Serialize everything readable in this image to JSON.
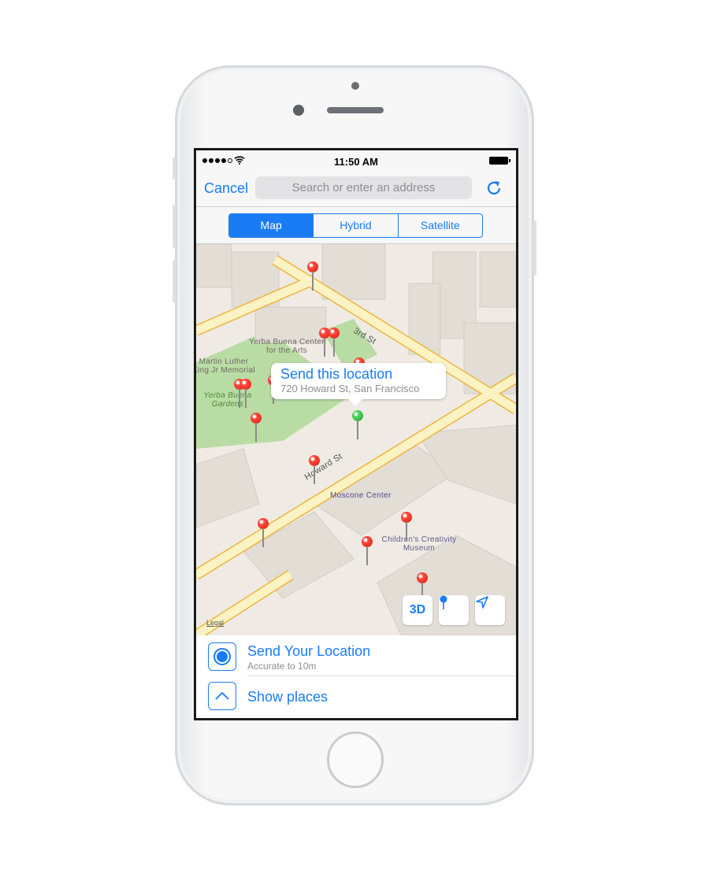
{
  "status_bar": {
    "time": "11:50 AM",
    "signal_bars": 4,
    "signal_max": 5
  },
  "nav": {
    "cancel_label": "Cancel",
    "search_placeholder": "Search or enter an address",
    "refresh_icon": "refresh-icon"
  },
  "segments": {
    "items": [
      "Map",
      "Hybrid",
      "Satellite"
    ],
    "selected": "Map"
  },
  "map": {
    "labels": {
      "yerba_center": "Yerba Buena Center for the Arts",
      "mlk": "Martin Luther King Jr Memorial",
      "gardens": "Yerba Buena Gardens",
      "third_st": "3rd St",
      "howard_st": "Howard St",
      "moscone": "Moscone Center",
      "childrens": "Children's Creativity Museum"
    },
    "callout": {
      "title": "Send this location",
      "subtitle": "720 Howard St, San Francisco"
    },
    "buttons": {
      "three_d": "3D",
      "pin": "pin-icon",
      "locate": "location-arrow-icon"
    },
    "legal": "Legal",
    "colors": {
      "pin_red": "#e8251a",
      "pin_green": "#3cc24b",
      "road": "#fbf3c4",
      "road_edge": "#f0b43c",
      "park": "#b9dca4"
    }
  },
  "panel": {
    "send_location": {
      "title": "Send Your Location",
      "subtitle": "Accurate to 10m"
    },
    "show_places": {
      "title": "Show places"
    }
  },
  "accent": "#1a7cf5"
}
